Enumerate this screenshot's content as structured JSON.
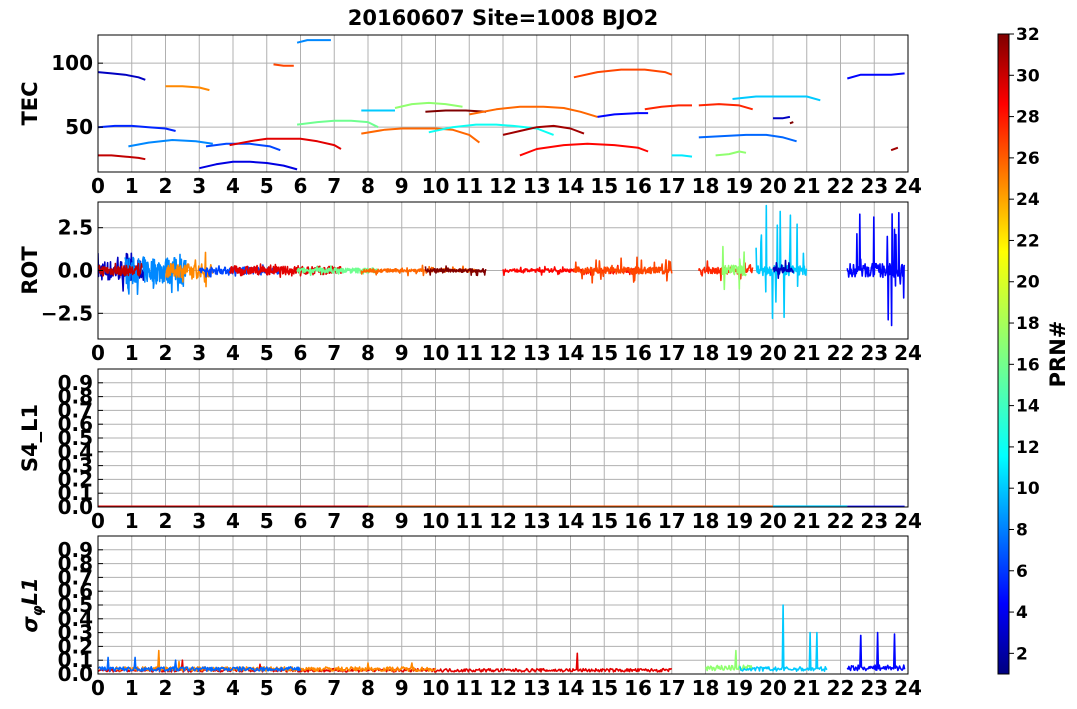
{
  "title": "20160607 Site=1008 BJO2",
  "x_ticks": [
    "0",
    "1",
    "2",
    "3",
    "4",
    "5",
    "6",
    "7",
    "8",
    "9",
    "10",
    "11",
    "12",
    "13",
    "14",
    "15",
    "16",
    "17",
    "18",
    "19",
    "20",
    "21",
    "22",
    "23",
    "24"
  ],
  "colorbar": {
    "label": "PRN#",
    "range": [
      1,
      32
    ],
    "ticks": [
      "2",
      "4",
      "6",
      "8",
      "10",
      "12",
      "14",
      "16",
      "18",
      "20",
      "22",
      "24",
      "26",
      "28",
      "30",
      "32"
    ],
    "colormap": "jet"
  },
  "chart_data": [
    {
      "type": "line",
      "ylabel": "TEC",
      "xlim": [
        0,
        24
      ],
      "ylim": [
        15,
        122
      ],
      "yticks": [
        {
          "value": 50,
          "label": "50"
        },
        {
          "value": 100,
          "label": "100"
        }
      ],
      "grid": true,
      "series": [
        {
          "prn": 3,
          "x": [
            0.0,
            0.4,
            0.8,
            1.2,
            1.4
          ],
          "y": [
            93,
            92,
            91,
            89,
            87
          ]
        },
        {
          "prn": 6,
          "x": [
            0.0,
            0.5,
            1.0,
            1.5,
            2.0,
            2.3
          ],
          "y": [
            50,
            51,
            51,
            50,
            49,
            47
          ]
        },
        {
          "prn": 30,
          "x": [
            0.0,
            0.4,
            0.8,
            1.2,
            1.4
          ],
          "y": [
            28,
            28,
            27,
            26,
            25
          ]
        },
        {
          "prn": 24,
          "x": [
            2.0,
            2.5,
            3.0,
            3.3
          ],
          "y": [
            82,
            82,
            81,
            79
          ]
        },
        {
          "prn": 9,
          "x": [
            0.9,
            1.5,
            2.2,
            2.9,
            3.4
          ],
          "y": [
            35,
            38,
            40,
            39,
            37
          ]
        },
        {
          "prn": 4,
          "x": [
            3.0,
            3.5,
            4.0,
            4.5,
            5.0,
            5.5,
            5.9
          ],
          "y": [
            18,
            21,
            23,
            23,
            22,
            20,
            17
          ]
        },
        {
          "prn": 7,
          "x": [
            3.2,
            3.8,
            4.5,
            5.1,
            5.4
          ],
          "y": [
            35,
            37,
            37,
            35,
            32
          ]
        },
        {
          "prn": 29,
          "x": [
            3.9,
            4.5,
            5.0,
            5.5,
            6.0,
            6.5,
            7.0,
            7.2
          ],
          "y": [
            36,
            39,
            41,
            41,
            41,
            39,
            36,
            33
          ]
        },
        {
          "prn": 9,
          "x": [
            5.9,
            6.2,
            6.6,
            6.9
          ],
          "y": [
            116,
            118,
            118,
            118
          ]
        },
        {
          "prn": 26,
          "x": [
            5.2,
            5.5,
            5.8
          ],
          "y": [
            99,
            98,
            98
          ]
        },
        {
          "prn": 16,
          "x": [
            5.9,
            6.5,
            7.0,
            7.5,
            8.0,
            8.3
          ],
          "y": [
            52,
            54,
            55,
            55,
            54,
            50
          ]
        },
        {
          "prn": 25,
          "x": [
            7.8,
            8.5,
            9.0,
            9.5,
            10.0,
            10.5,
            11.0,
            11.3
          ],
          "y": [
            45,
            48,
            49,
            49,
            49,
            48,
            44,
            38
          ]
        },
        {
          "prn": 11,
          "x": [
            7.8,
            8.3,
            8.8
          ],
          "y": [
            63,
            63,
            63
          ]
        },
        {
          "prn": 17,
          "x": [
            8.8,
            9.3,
            9.8,
            10.3,
            10.8
          ],
          "y": [
            65,
            68,
            69,
            68,
            66
          ]
        },
        {
          "prn": 32,
          "x": [
            9.7,
            10.3,
            10.9,
            11.5
          ],
          "y": [
            62,
            63,
            63,
            62
          ]
        },
        {
          "prn": 13,
          "x": [
            9.8,
            10.5,
            11.2,
            11.8,
            12.3,
            13.0,
            13.5
          ],
          "y": [
            46,
            50,
            52,
            52,
            51,
            49,
            44
          ]
        },
        {
          "prn": 25,
          "x": [
            11.0,
            11.8,
            12.5,
            13.2,
            13.8,
            14.3,
            14.8
          ],
          "y": [
            60,
            64,
            66,
            66,
            65,
            62,
            58
          ]
        },
        {
          "prn": 31,
          "x": [
            12.0,
            12.5,
            13.0,
            13.5,
            14.0,
            14.4
          ],
          "y": [
            44,
            47,
            50,
            51,
            49,
            45
          ]
        },
        {
          "prn": 28,
          "x": [
            12.5,
            13.0,
            13.8,
            14.5,
            15.3,
            16.0,
            16.3
          ],
          "y": [
            28,
            33,
            36,
            37,
            36,
            34,
            31
          ]
        },
        {
          "prn": 26,
          "x": [
            14.1,
            14.8,
            15.5,
            16.2,
            16.8,
            17.0
          ],
          "y": [
            89,
            93,
            95,
            95,
            93,
            91
          ]
        },
        {
          "prn": 5,
          "x": [
            14.8,
            15.3,
            16.0,
            16.3
          ],
          "y": [
            58,
            60,
            61,
            61
          ]
        },
        {
          "prn": 27,
          "x": [
            16.2,
            16.7,
            17.2,
            17.6
          ],
          "y": [
            64,
            66,
            67,
            67
          ]
        },
        {
          "prn": 27,
          "x": [
            17.8,
            18.4,
            19.0,
            19.4
          ],
          "y": [
            67,
            68,
            67,
            64
          ]
        },
        {
          "prn": 12,
          "x": [
            17.0,
            17.3,
            17.6
          ],
          "y": [
            28,
            28,
            27
          ]
        },
        {
          "prn": 11,
          "x": [
            18.8,
            19.5,
            20.3,
            21.0,
            21.4
          ],
          "y": [
            72,
            74,
            74,
            74,
            71
          ]
        },
        {
          "prn": 8,
          "x": [
            17.8,
            18.5,
            19.2,
            19.8,
            20.3,
            20.7
          ],
          "y": [
            42,
            43,
            44,
            44,
            42,
            39
          ]
        },
        {
          "prn": 17,
          "x": [
            18.3,
            18.7,
            19.0,
            19.2
          ],
          "y": [
            28,
            29,
            31,
            30
          ]
        },
        {
          "prn": 3,
          "x": [
            20.0,
            20.3,
            20.5
          ],
          "y": [
            57,
            57,
            58
          ]
        },
        {
          "prn": 32,
          "x": [
            20.5,
            20.6
          ],
          "y": [
            53,
            54
          ]
        },
        {
          "prn": 5,
          "x": [
            22.2,
            22.6,
            23.0,
            23.5,
            23.9
          ],
          "y": [
            88,
            91,
            91,
            91,
            92
          ]
        },
        {
          "prn": 31,
          "x": [
            23.5,
            23.7
          ],
          "y": [
            32,
            34
          ]
        }
      ]
    },
    {
      "type": "line",
      "ylabel": "ROT",
      "xlim": [
        0,
        24
      ],
      "ylim": [
        -4,
        4
      ],
      "yticks": [
        {
          "value": -2.5,
          "label": "−2.5"
        },
        {
          "value": 0,
          "label": "0.0"
        },
        {
          "value": 2.5,
          "label": "2.5"
        }
      ],
      "grid": true,
      "series": [
        {
          "prn": 3,
          "x": [
            0.0,
            1.4
          ],
          "amp": [
            0.6,
            1.2
          ]
        },
        {
          "prn": 9,
          "x": [
            0.8,
            2.6
          ],
          "amp": [
            0.8,
            1.4
          ]
        },
        {
          "prn": 30,
          "x": [
            0.0,
            1.3
          ],
          "amp": [
            0.3,
            0.6
          ]
        },
        {
          "prn": 24,
          "x": [
            2.0,
            3.4
          ],
          "amp": [
            0.4,
            1.2
          ]
        },
        {
          "prn": 7,
          "x": [
            3.0,
            5.4
          ],
          "amp": [
            0.2,
            0.4
          ]
        },
        {
          "prn": 29,
          "x": [
            3.9,
            7.2
          ],
          "amp": [
            0.25,
            0.4
          ]
        },
        {
          "prn": 16,
          "x": [
            5.9,
            8.3
          ],
          "amp": [
            0.15,
            0.3
          ]
        },
        {
          "prn": 25,
          "x": [
            7.8,
            11.3
          ],
          "amp": [
            0.1,
            0.3
          ]
        },
        {
          "prn": 32,
          "x": [
            9.7,
            11.5
          ],
          "amp": [
            0.1,
            0.3
          ]
        },
        {
          "prn": 28,
          "x": [
            12.0,
            16.0
          ],
          "amp": [
            0.1,
            0.3
          ]
        },
        {
          "prn": 26,
          "x": [
            14.1,
            17.0
          ],
          "amp": [
            0.2,
            0.8
          ]
        },
        {
          "prn": 27,
          "x": [
            17.8,
            19.4
          ],
          "amp": [
            0.2,
            0.6
          ]
        },
        {
          "prn": 17,
          "x": [
            18.5,
            19.2
          ],
          "amp": [
            0.3,
            1.4
          ]
        },
        {
          "prn": 11,
          "x": [
            19.5,
            21.0
          ],
          "amp": [
            0.3,
            3.8
          ]
        },
        {
          "prn": 3,
          "x": [
            20.0,
            20.6
          ],
          "amp": [
            0.2,
            0.6
          ]
        },
        {
          "prn": 5,
          "x": [
            22.2,
            23.9
          ],
          "amp": [
            0.4,
            3.9
          ]
        }
      ]
    },
    {
      "type": "line",
      "ylabel": "S4_L1",
      "xlim": [
        0,
        24
      ],
      "ylim": [
        0,
        1
      ],
      "yticks": [
        {
          "value": 0.0,
          "label": "0.0"
        },
        {
          "value": 0.1,
          "label": "0.1"
        },
        {
          "value": 0.2,
          "label": "0.2"
        },
        {
          "value": 0.3,
          "label": "0.3"
        },
        {
          "value": 0.4,
          "label": "0.4"
        },
        {
          "value": 0.5,
          "label": "0.5"
        },
        {
          "value": 0.6,
          "label": "0.6"
        },
        {
          "value": 0.7,
          "label": "0.7"
        },
        {
          "value": 0.8,
          "label": "0.8"
        },
        {
          "value": 0.9,
          "label": "0.9"
        }
      ],
      "grid": true,
      "series": [
        {
          "prn": 29,
          "x": [
            0.0,
            20.0
          ],
          "y": [
            0.005,
            0.005
          ]
        },
        {
          "prn": 25,
          "x": [
            8.0,
            21.0
          ],
          "y": [
            0.004,
            0.004
          ]
        },
        {
          "prn": 11,
          "x": [
            20.0,
            22.2
          ],
          "y": [
            0.006,
            0.006
          ]
        },
        {
          "prn": 5,
          "x": [
            22.2,
            23.9
          ],
          "y": [
            0.004,
            0.004
          ]
        }
      ]
    },
    {
      "type": "line",
      "ylabel": "σφL1",
      "xlim": [
        0,
        24
      ],
      "ylim": [
        0,
        1
      ],
      "yticks": [
        {
          "value": 0.0,
          "label": "0.0"
        },
        {
          "value": 0.1,
          "label": "0.1"
        },
        {
          "value": 0.2,
          "label": "0.2"
        },
        {
          "value": 0.3,
          "label": "0.3"
        },
        {
          "value": 0.4,
          "label": "0.4"
        },
        {
          "value": 0.5,
          "label": "0.5"
        },
        {
          "value": 0.6,
          "label": "0.6"
        },
        {
          "value": 0.7,
          "label": "0.7"
        },
        {
          "value": 0.8,
          "label": "0.8"
        },
        {
          "value": 0.9,
          "label": "0.9"
        }
      ],
      "grid": true,
      "series": [
        {
          "prn": 29,
          "x": [
            0.0,
            17.0
          ],
          "base": 0.03,
          "spikes": [
            [
              0.3,
              0.1
            ],
            [
              1.8,
              0.12
            ],
            [
              2.5,
              0.1
            ],
            [
              4.8,
              0.07
            ],
            [
              14.2,
              0.15
            ]
          ]
        },
        {
          "prn": 24,
          "x": [
            0.5,
            10.0
          ],
          "base": 0.04,
          "spikes": [
            [
              1.8,
              0.17
            ],
            [
              2.4,
              0.09
            ],
            [
              8.0,
              0.08
            ],
            [
              9.3,
              0.08
            ]
          ]
        },
        {
          "prn": 8,
          "x": [
            0.0,
            6.0
          ],
          "base": 0.04,
          "spikes": [
            [
              0.3,
              0.12
            ],
            [
              1.1,
              0.12
            ],
            [
              2.3,
              0.1
            ]
          ]
        },
        {
          "prn": 17,
          "x": [
            18.0,
            19.4
          ],
          "base": 0.05,
          "spikes": [
            [
              18.9,
              0.17
            ]
          ]
        },
        {
          "prn": 11,
          "x": [
            19.0,
            21.6
          ],
          "base": 0.04,
          "spikes": [
            [
              20.3,
              0.5
            ],
            [
              21.1,
              0.3
            ],
            [
              21.3,
              0.3
            ]
          ]
        },
        {
          "prn": 5,
          "x": [
            22.2,
            23.9
          ],
          "base": 0.05,
          "spikes": [
            [
              22.6,
              0.28
            ],
            [
              23.1,
              0.3
            ],
            [
              23.6,
              0.29
            ]
          ]
        }
      ]
    }
  ]
}
